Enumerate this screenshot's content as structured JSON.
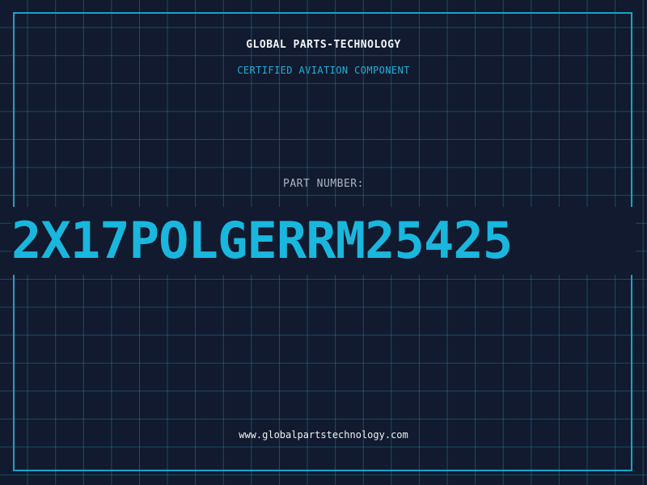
{
  "header": {
    "company": "GLOBAL PARTS-TECHNOLOGY",
    "tagline": "CERTIFIED AVIATION COMPONENT"
  },
  "part": {
    "label": "PART NUMBER:",
    "number": "2X17POLGERRM25425"
  },
  "footer": {
    "website": "www.globalpartstechnology.com"
  },
  "colors": {
    "background": "#111a2e",
    "grid": "#207896",
    "accent": "#19b7de",
    "text": "#f2f5f8"
  }
}
